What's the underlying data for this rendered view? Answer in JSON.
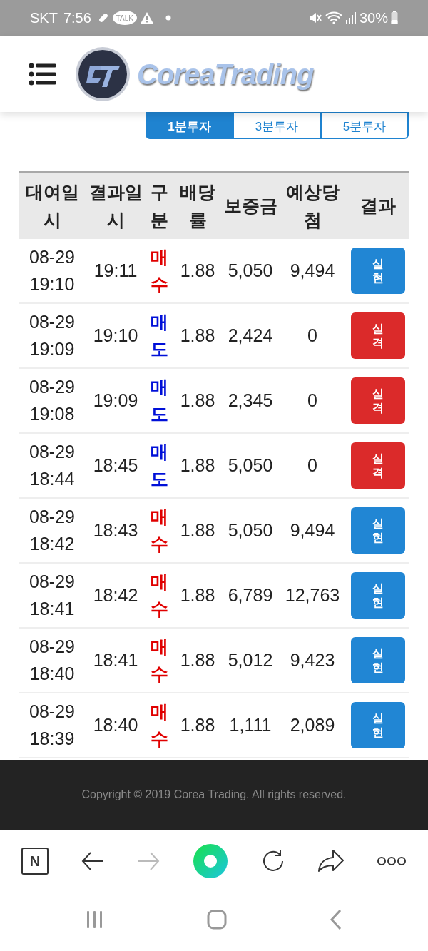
{
  "status_bar": {
    "carrier": "SKT",
    "time": "7:56",
    "talk_badge": "TALK",
    "battery": "30%"
  },
  "header": {
    "logo_text": "CoreaTrading"
  },
  "tabs": [
    {
      "label": "1분투자",
      "selected": true
    },
    {
      "label": "3분투자",
      "selected": false
    },
    {
      "label": "5분투자",
      "selected": false
    }
  ],
  "table": {
    "columns": [
      "대여일시",
      "결과일시",
      "구분",
      "배당률",
      "보증금",
      "예상당첨",
      "결과"
    ],
    "rows": [
      {
        "rent_time": "08-29\n19:10",
        "result_time": "19:11",
        "type": {
          "label": "매수",
          "kind": "buy"
        },
        "rate": "1.88",
        "deposit": "5,050",
        "expected": "9,494",
        "result": {
          "label": "실현",
          "kind": "win"
        }
      },
      {
        "rent_time": "08-29\n19:09",
        "result_time": "19:10",
        "type": {
          "label": "매도",
          "kind": "sell"
        },
        "rate": "1.88",
        "deposit": "2,424",
        "expected": "0",
        "result": {
          "label": "실격",
          "kind": "lose"
        }
      },
      {
        "rent_time": "08-29\n19:08",
        "result_time": "19:09",
        "type": {
          "label": "매도",
          "kind": "sell"
        },
        "rate": "1.88",
        "deposit": "2,345",
        "expected": "0",
        "result": {
          "label": "실격",
          "kind": "lose"
        }
      },
      {
        "rent_time": "08-29\n18:44",
        "result_time": "18:45",
        "type": {
          "label": "매도",
          "kind": "sell"
        },
        "rate": "1.88",
        "deposit": "5,050",
        "expected": "0",
        "result": {
          "label": "실격",
          "kind": "lose"
        }
      },
      {
        "rent_time": "08-29\n18:42",
        "result_time": "18:43",
        "type": {
          "label": "매수",
          "kind": "buy"
        },
        "rate": "1.88",
        "deposit": "5,050",
        "expected": "9,494",
        "result": {
          "label": "실현",
          "kind": "win"
        }
      },
      {
        "rent_time": "08-29\n18:41",
        "result_time": "18:42",
        "type": {
          "label": "매수",
          "kind": "buy"
        },
        "rate": "1.88",
        "deposit": "6,789",
        "expected": "12,763",
        "result": {
          "label": "실현",
          "kind": "win"
        }
      },
      {
        "rent_time": "08-29\n18:40",
        "result_time": "18:41",
        "type": {
          "label": "매수",
          "kind": "buy"
        },
        "rate": "1.88",
        "deposit": "5,012",
        "expected": "9,423",
        "result": {
          "label": "실현",
          "kind": "win"
        }
      },
      {
        "rent_time": "08-29\n18:39",
        "result_time": "18:40",
        "type": {
          "label": "매수",
          "kind": "buy"
        },
        "rate": "1.88",
        "deposit": "1,111",
        "expected": "2,089",
        "result": {
          "label": "실현",
          "kind": "win"
        }
      }
    ]
  },
  "footer": {
    "copyright": "Copyright © 2019 Corea Trading. All rights reserved."
  },
  "browser_toolbar": {
    "n_button": "N"
  }
}
